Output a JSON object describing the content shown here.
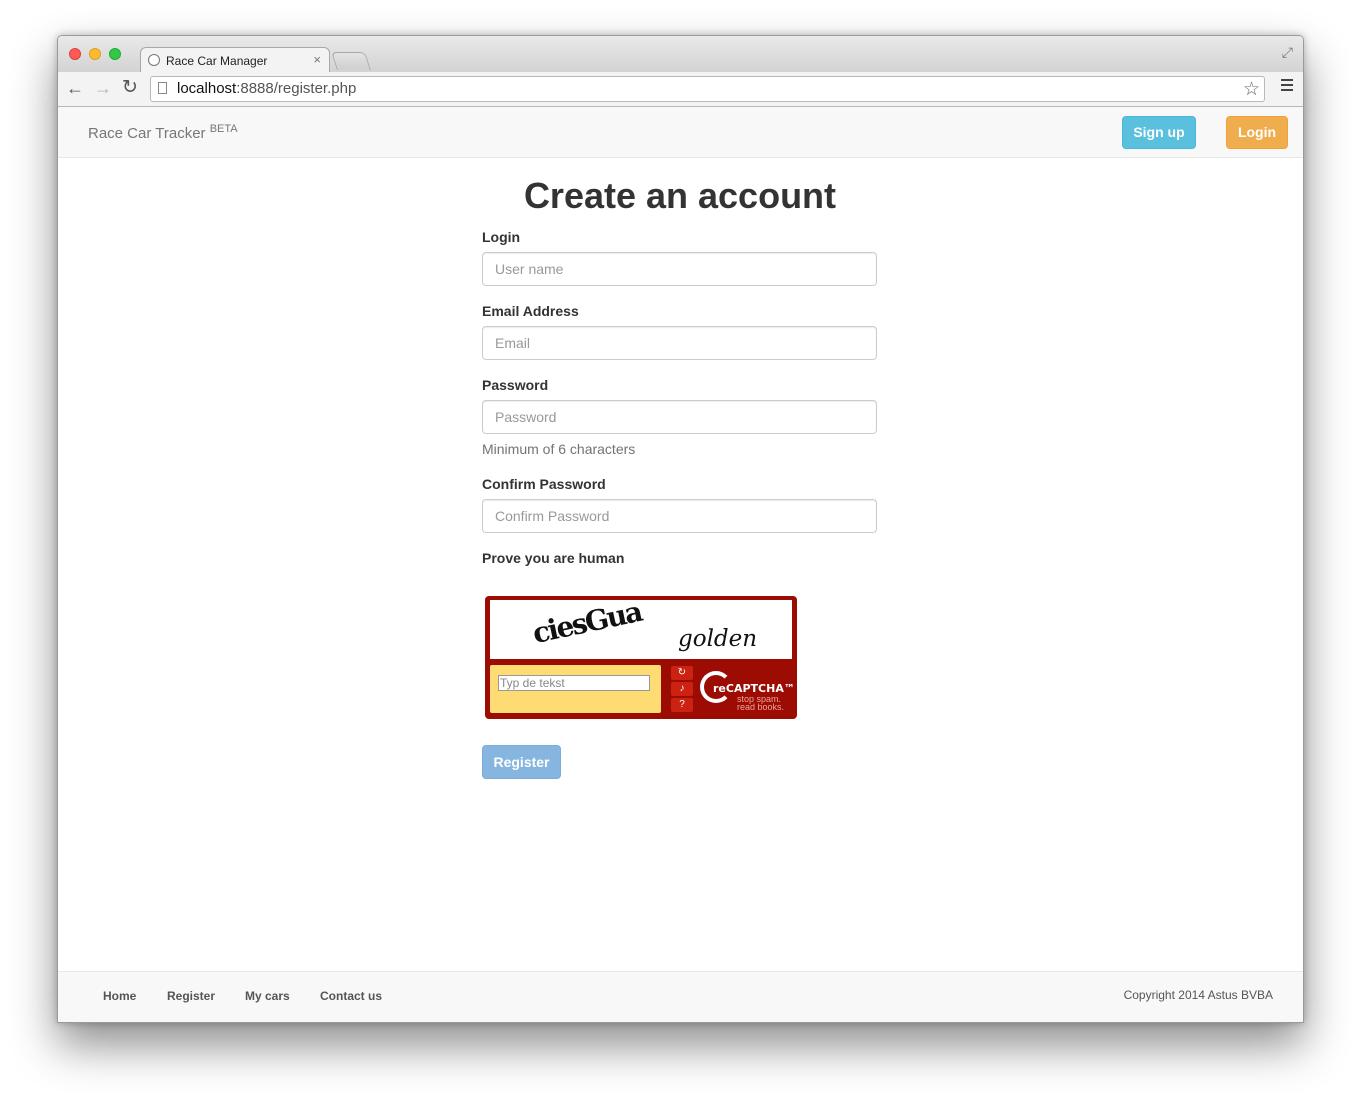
{
  "browser": {
    "tab_title": "Race Car Manager",
    "tab_close": "×",
    "url_host": "localhost",
    "url_rest": ":8888/register.php",
    "icons": [
      "back-icon",
      "forward-icon",
      "reload-icon",
      "page-icon",
      "star-icon",
      "menu-icon",
      "fullscreen-icon"
    ]
  },
  "navbar": {
    "brand": "Race Car Tracker",
    "brand_badge": "BETA",
    "signup_label": "Sign up",
    "login_label": "Login",
    "signup_color": "#5bc0de",
    "login_color": "#f0ad4e"
  },
  "form": {
    "title": "Create an account",
    "login_label": "Login",
    "login_placeholder": "User name",
    "email_label": "Email Address",
    "email_placeholder": "Email",
    "password_label": "Password",
    "password_placeholder": "Password",
    "password_help": "Minimum of 6 characters",
    "confirm_label": "Confirm Password",
    "confirm_placeholder": "Confirm Password",
    "captcha_label": "Prove you are human",
    "register_label": "Register"
  },
  "captcha": {
    "word1": "ciesGua",
    "word2": "golden",
    "input_placeholder": "Typ de tekst",
    "brand": "reCAPTCHA™",
    "slogan_line1": "stop spam.",
    "slogan_line2": "read books."
  },
  "footer": {
    "links": [
      "Home",
      "Register",
      "My cars",
      "Contact us"
    ],
    "copyright": "Copyright 2014 Astus BVBA"
  }
}
